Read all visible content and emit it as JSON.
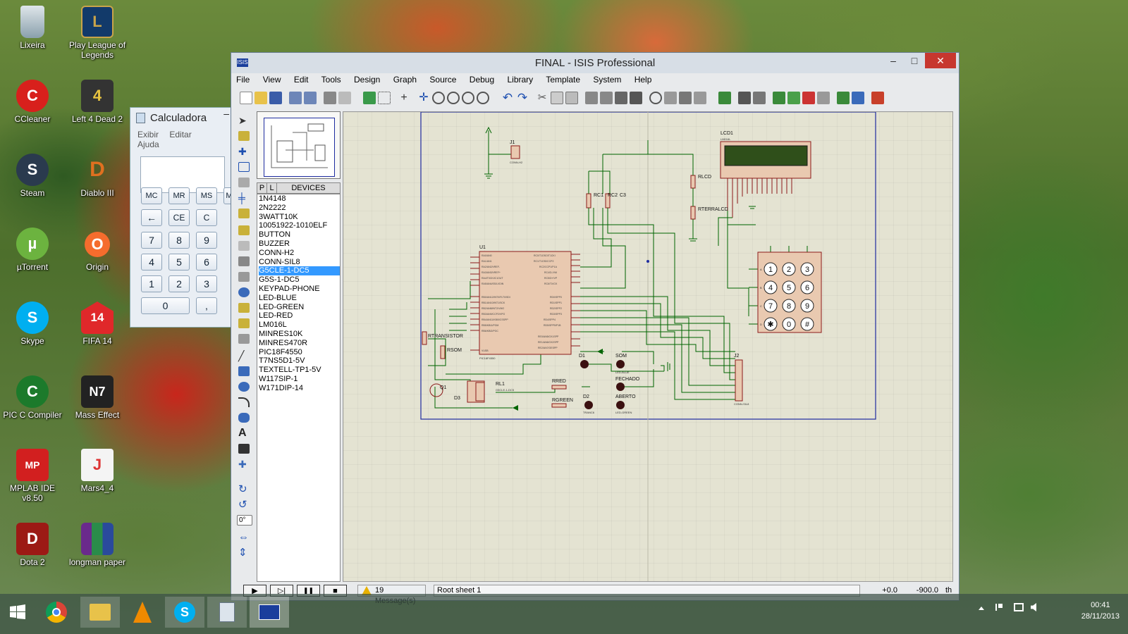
{
  "desktop": {
    "icons": [
      {
        "label": "Lixeira",
        "icon": "recycle-bin-icon"
      },
      {
        "label": "Play League of Legends",
        "icon": "league-of-legends-icon"
      },
      {
        "label": "CCleaner",
        "icon": "ccleaner-icon"
      },
      {
        "label": "Left 4 Dead 2",
        "icon": "left4dead2-icon"
      },
      {
        "label": "Steam",
        "icon": "steam-icon"
      },
      {
        "label": "Diablo III",
        "icon": "diablo-icon"
      },
      {
        "label": "µTorrent",
        "icon": "utorrent-icon"
      },
      {
        "label": "Origin",
        "icon": "origin-icon"
      },
      {
        "label": "Skype",
        "icon": "skype-icon"
      },
      {
        "label": "FIFA 14",
        "icon": "fifa-icon"
      },
      {
        "label": "PIC C Compiler",
        "icon": "pic-c-icon"
      },
      {
        "label": "Mass Effect",
        "icon": "mass-effect-icon"
      },
      {
        "label": "MPLAB IDE v8.50",
        "icon": "mplab-icon"
      },
      {
        "label": "Mars4_4",
        "icon": "java-icon"
      },
      {
        "label": "Dota 2",
        "icon": "dota-icon"
      },
      {
        "label": "longman paper",
        "icon": "winrar-icon"
      }
    ]
  },
  "calculator": {
    "title": "Calculadora",
    "min_glyph": "–",
    "menu": [
      "Exibir",
      "Editar",
      "Ajuda"
    ],
    "memory": [
      "MC",
      "MR",
      "MS",
      "M"
    ],
    "row2": [
      "←",
      "CE",
      "C"
    ],
    "digits": [
      "7",
      "8",
      "9",
      "4",
      "5",
      "6",
      "1",
      "2",
      "3"
    ],
    "zero": "0",
    "comma": ","
  },
  "window": {
    "title": "FINAL - ISIS Professional",
    "app_badge": "ISIS",
    "controls": {
      "minimize": "–",
      "maximize": "□",
      "close": "✕"
    },
    "menu": [
      "File",
      "View",
      "Edit",
      "Tools",
      "Design",
      "Graph",
      "Source",
      "Debug",
      "Library",
      "Template",
      "System",
      "Help"
    ],
    "devices_header": {
      "p": "P",
      "l": "L",
      "label": "DEVICES"
    },
    "devices": [
      "1N4148",
      "2N2222",
      "3WATT10K",
      "10051922-1010ELF",
      "BUTTON",
      "BUZZER",
      "CONN-H2",
      "CONN-SIL8",
      "G5CLE-1-DC5",
      "G5S-1-DC5",
      "KEYPAD-PHONE",
      "LED-BLUE",
      "LED-GREEN",
      "LED-RED",
      "LM016L",
      "MINRES10K",
      "MINRES470R",
      "PIC18F4550",
      "T7NS5D1-5V",
      "TEXTELL-TP1-5V",
      "W117SIP-1",
      "W171DIP-14"
    ],
    "selected_device": "G5CLE-1-DC5",
    "rotation": "0°",
    "status": {
      "play": "▶",
      "step": "▷|",
      "pause": "❚❚",
      "stop": "■",
      "messages": "19 Message(s)",
      "sheet": "Root sheet 1",
      "x": "+0.0",
      "y": "-900.0",
      "unit": "th"
    }
  },
  "schematic": {
    "labels": {
      "lcd": "LCD1",
      "lcd_model": "LM016L",
      "u1": "U1",
      "u1_model": "PIC18F4550",
      "j1": "J1",
      "j1_model": "CONN-H2",
      "j2": "J2",
      "j2_model": "CONN-SIL8",
      "rc1": "RC1",
      "rc2": "RC2",
      "c3": "C3",
      "rlcd": "RLCD",
      "rterra": "RTERRALCD",
      "rtransistor": "RTRANSISTOR",
      "rsom": "RSOM",
      "q1": "Q1",
      "d3": "D3",
      "rl1": "RL1",
      "rl1_model": "G5CLE-1-DC5",
      "rred": "RRED",
      "rgreen": "RGREEN",
      "d1": "D1",
      "d2": "D2",
      "som": "SOM",
      "fechado": "FECHADO",
      "aberto": "ABERTO",
      "led_blue": "LED-BLUE",
      "led_green": "LED-GREEN",
      "trancado": "TRANC6",
      "text": "<TEXT>"
    },
    "keypad": [
      "1",
      "2",
      "3",
      "4",
      "5",
      "6",
      "7",
      "8",
      "9",
      "✱",
      "0",
      "#"
    ],
    "keypad_rows": [
      "A",
      "B",
      "C",
      "D"
    ]
  },
  "taskbar": {
    "apps": [
      "windows-start-icon",
      "chrome-icon",
      "file-explorer-icon",
      "vlc-icon",
      "skype-icon",
      "calculator-icon",
      "isis-icon"
    ],
    "clock_time": "00:41",
    "clock_date": "28/11/2013"
  },
  "colors": {
    "accent": "#1a3e9c",
    "close": "#c7372f",
    "selected": "#3399ff",
    "wire": "#006400",
    "component": "#8b1a1a"
  }
}
